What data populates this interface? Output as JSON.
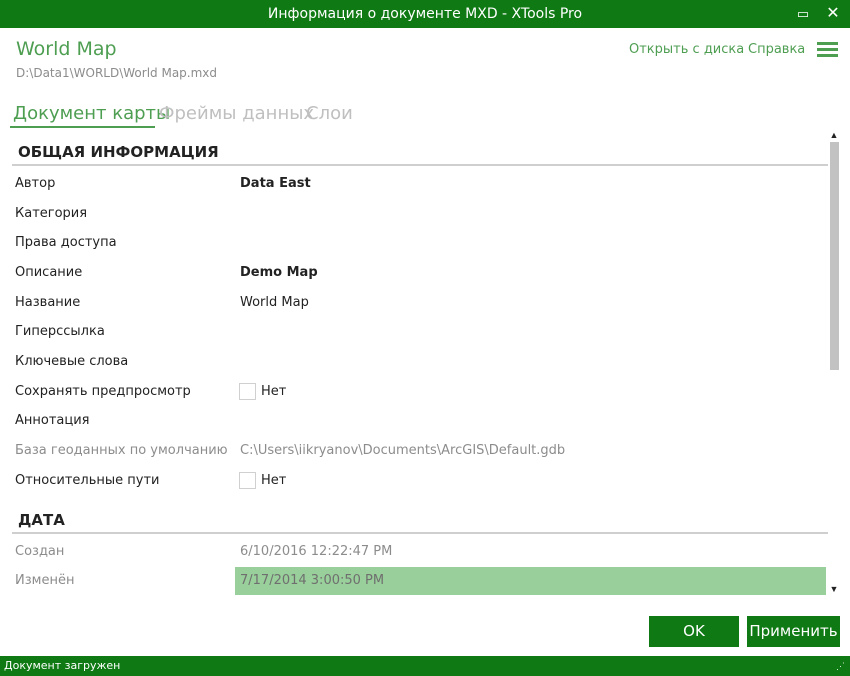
{
  "window": {
    "title": "Информация о документе MXD - XTools Pro",
    "maximize_glyph": "▭",
    "close_glyph": "✕"
  },
  "header": {
    "doc_title": "World Map",
    "doc_path": "D:\\Data1\\WORLD\\World Map.mxd",
    "open_from_disk": "Открыть с диска",
    "help": "Справка",
    "menu_icon": "hamburger-menu-icon"
  },
  "tabs": [
    {
      "label": "Документ карты",
      "active": true
    },
    {
      "label": "Фреймы данных",
      "active": false
    },
    {
      "label": "Слои",
      "active": false
    }
  ],
  "sections": {
    "general": {
      "title": "ОБЩАЯ ИНФОРМАЦИЯ",
      "rows": {
        "author": {
          "label": "Автор",
          "value": "Data East"
        },
        "category": {
          "label": "Категория",
          "value": ""
        },
        "access_rights": {
          "label": "Права доступа",
          "value": ""
        },
        "description": {
          "label": "Описание",
          "value": "Demo Map"
        },
        "name": {
          "label": "Название",
          "value": "World Map"
        },
        "hyperlink": {
          "label": "Гиперссылка",
          "value": ""
        },
        "keywords": {
          "label": "Ключевые слова",
          "value": ""
        },
        "save_preview": {
          "label": "Сохранять предпросмотр",
          "checked": false,
          "check_label": "Нет"
        },
        "annotation": {
          "label": "Аннотация",
          "value": ""
        },
        "default_gdb": {
          "label": "База геоданных по умолчанию",
          "value": "C:\\Users\\iikryanov\\Documents\\ArcGIS\\Default.gdb"
        },
        "relative_paths": {
          "label": "Относительные пути",
          "checked": false,
          "check_label": "Нет"
        }
      }
    },
    "date": {
      "title": "ДАТА",
      "rows": {
        "created": {
          "label": "Создан",
          "value": "6/10/2016 12:22:47 PM"
        },
        "modified": {
          "label": "Изменён",
          "value": "7/17/2014 3:00:50 PM"
        }
      }
    }
  },
  "scroll": {
    "up_glyph": "▲",
    "down_glyph": "▼"
  },
  "buttons": {
    "ok": "OK",
    "apply": "Применить"
  },
  "status": {
    "text": "Документ загружен",
    "grip": "⋰"
  },
  "colors": {
    "brand_green": "#0f7a14",
    "accent_green": "#4e9e52",
    "highlight_green": "#99cf9a"
  }
}
